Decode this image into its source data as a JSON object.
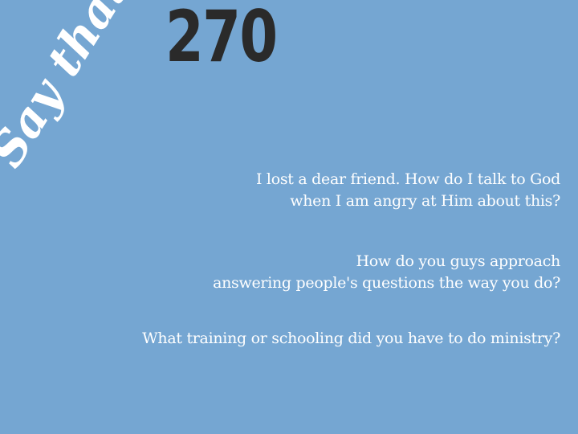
{
  "brand": {
    "logo_text": "Say that."
  },
  "episode": {
    "number": "270"
  },
  "questions": [
    {
      "lines": [
        "I lost a dear friend. How do I talk to God",
        "when I am angry at Him about this?"
      ]
    },
    {
      "lines": [
        "How do you guys approach",
        "answering people's questions the way you do?"
      ]
    },
    {
      "lines": [
        "What training or schooling did you have to do ministry?"
      ]
    }
  ],
  "colors": {
    "background": "#75a6d2",
    "episode_number": "#2a2a2a",
    "question_text": "#ffffff"
  }
}
